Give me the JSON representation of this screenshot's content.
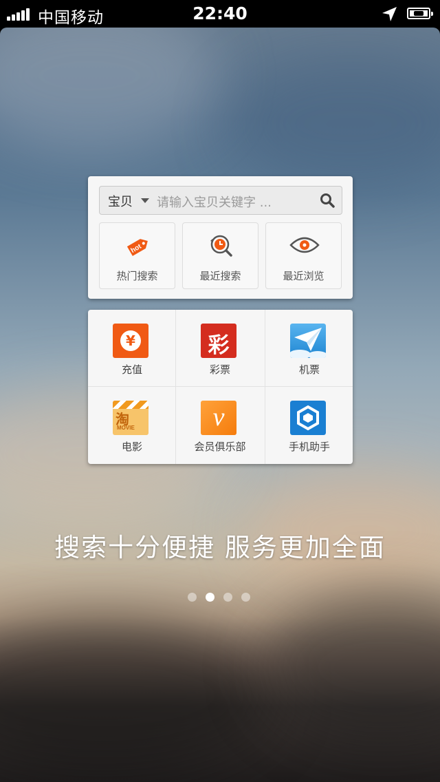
{
  "status_bar": {
    "carrier": "中国移动",
    "time": "22:40"
  },
  "search_card": {
    "scope_label": "宝贝",
    "search_placeholder": "请输入宝贝关键字 ...",
    "quick_actions": [
      {
        "label": "热门搜索",
        "icon": "hot-tag-icon"
      },
      {
        "label": "最近搜索",
        "icon": "recent-search-clock-icon"
      },
      {
        "label": "最近浏览",
        "icon": "eye-icon"
      }
    ]
  },
  "services": [
    {
      "label": "充值",
      "icon": "recharge-yen-icon"
    },
    {
      "label": "彩票",
      "icon": "lottery-icon",
      "icon_text": "彩"
    },
    {
      "label": "机票",
      "icon": "paper-plane-icon"
    },
    {
      "label": "电影",
      "icon": "movie-clapper-icon",
      "icon_text": "淘",
      "icon_subtext": "MOVIE"
    },
    {
      "label": "会员俱乐部",
      "icon": "vip-club-icon",
      "icon_text": "v"
    },
    {
      "label": "手机助手",
      "icon": "phone-assistant-icon"
    }
  ],
  "tagline": "搜索十分便捷  服务更加全面",
  "pager": {
    "total": 4,
    "current": 2
  },
  "colors": {
    "accent_orange": "#f05a14",
    "lottery_red": "#d42d1f",
    "plane_blue": "#2a8fd6",
    "assistant_blue": "#1a7fd2"
  }
}
